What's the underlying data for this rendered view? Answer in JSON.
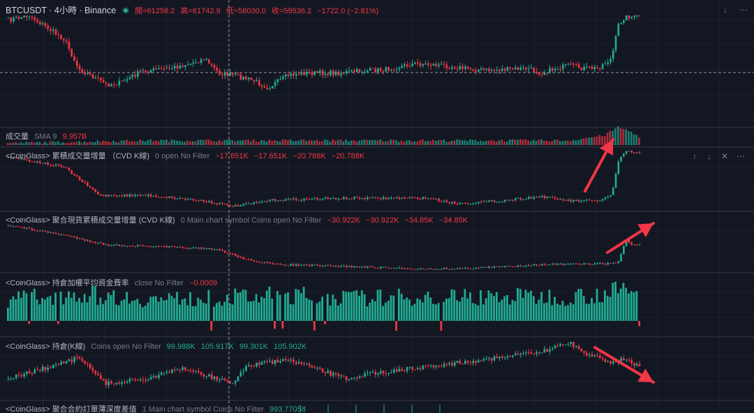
{
  "header": {
    "symbol": "BTCUSDT · 4小時 · Binance",
    "open": "開=61258.2",
    "high": "高=61742.9",
    "low": "低=58030.0",
    "close": "收=59536.2",
    "change": "−1722.0 (−2.81%)"
  },
  "colors": {
    "up": "#22ab94",
    "down": "#f23645",
    "arrow": "#f23645",
    "bg": "#131722"
  },
  "panels": {
    "volume": {
      "name": "成交量",
      "params": "SMA 9",
      "value": "9.957B"
    },
    "cvd": {
      "name": "<CoinGlass> 累積成交量增量 （CVD K線)",
      "params": "0 open No Filter",
      "values": [
        "−17.651K",
        "−17.651K",
        "−20.788K",
        "−20.788K"
      ]
    },
    "spot_cvd": {
      "name": "<CoinGlass> 聚合現貨累積成交量增量 (CVD K線)",
      "params": "0 Main chart symbol Coins open No Filter",
      "values": [
        "−30.922K",
        "−30.922K",
        "−34.85K",
        "−34.85K"
      ]
    },
    "funding": {
      "name": "<CoinGlass> 持倉加權平均資金費率",
      "params": "close No Filter",
      "value": "−0.0009"
    },
    "oi": {
      "name": "<CoinGlass> 持倉(K線)",
      "params": "Coins open No Filter",
      "values": [
        "99.988K",
        "105.917K",
        "99.301K",
        "105.902K"
      ]
    },
    "depth": {
      "name": "<CoinGlass> 聚合合約訂單薄深度差值",
      "params": "1 Main chart symbol Coins No Filter",
      "value": "993.77058"
    }
  },
  "chart_data": [
    {
      "type": "candlestick",
      "name": "BTCUSDT 4h price",
      "points": [
        [
          0,
          0.05
        ],
        [
          3,
          0.0
        ],
        [
          8,
          0.25
        ],
        [
          10,
          0.55
        ],
        [
          14,
          0.72
        ],
        [
          16,
          0.7
        ],
        [
          19,
          0.58
        ],
        [
          23,
          0.55
        ],
        [
          26,
          0.5
        ],
        [
          28,
          0.45
        ],
        [
          30,
          0.6
        ],
        [
          32,
          0.62
        ],
        [
          35,
          0.68
        ],
        [
          37,
          0.75
        ],
        [
          40,
          0.62
        ],
        [
          42,
          0.6
        ],
        [
          47,
          0.6
        ],
        [
          50,
          0.58
        ],
        [
          54,
          0.56
        ],
        [
          58,
          0.5
        ],
        [
          62,
          0.52
        ],
        [
          65,
          0.55
        ],
        [
          68,
          0.57
        ],
        [
          71,
          0.56
        ],
        [
          74,
          0.55
        ],
        [
          76,
          0.6
        ],
        [
          78,
          0.55
        ],
        [
          80,
          0.52
        ],
        [
          82,
          0.55
        ],
        [
          84,
          0.55
        ],
        [
          86,
          0.45
        ],
        [
          87,
          0.1
        ],
        [
          88,
          0.0
        ],
        [
          89,
          0.02
        ],
        [
          90,
          0.0
        ]
      ]
    },
    {
      "type": "volume",
      "name": "Volume",
      "points": [
        [
          0,
          0.05
        ],
        [
          20,
          0.2
        ],
        [
          40,
          0.2
        ],
        [
          60,
          0.2
        ],
        [
          80,
          0.2
        ],
        [
          85,
          0.5
        ],
        [
          87,
          1.0
        ],
        [
          89,
          0.7
        ],
        [
          90,
          0.4
        ]
      ]
    },
    {
      "type": "candlestick",
      "name": "CVD",
      "points": [
        [
          0,
          0.1
        ],
        [
          8,
          0.3
        ],
        [
          13,
          0.8
        ],
        [
          20,
          0.8
        ],
        [
          28,
          0.9
        ],
        [
          32,
          1.0
        ],
        [
          38,
          0.88
        ],
        [
          50,
          0.85
        ],
        [
          60,
          0.85
        ],
        [
          64,
          0.95
        ],
        [
          70,
          0.9
        ],
        [
          76,
          0.82
        ],
        [
          80,
          0.9
        ],
        [
          84,
          0.9
        ],
        [
          86,
          0.8
        ],
        [
          87,
          0.2
        ],
        [
          88,
          0.0
        ],
        [
          89,
          0.03
        ],
        [
          90,
          0.05
        ]
      ]
    },
    {
      "type": "candlestick",
      "name": "Spot CVD",
      "points": [
        [
          0,
          0.1
        ],
        [
          8,
          0.3
        ],
        [
          14,
          0.5
        ],
        [
          24,
          0.55
        ],
        [
          30,
          0.6
        ],
        [
          34,
          0.8
        ],
        [
          38,
          0.9
        ],
        [
          50,
          0.95
        ],
        [
          60,
          1.0
        ],
        [
          65,
          0.98
        ],
        [
          70,
          0.95
        ],
        [
          76,
          0.9
        ],
        [
          80,
          0.9
        ],
        [
          86,
          0.88
        ],
        [
          87,
          0.85
        ],
        [
          88,
          0.4
        ],
        [
          89,
          0.5
        ],
        [
          90,
          0.5
        ]
      ]
    },
    {
      "type": "bar",
      "name": "Funding rate",
      "points": [
        [
          0,
          0.7
        ],
        [
          10,
          0.9
        ],
        [
          20,
          0.7
        ],
        [
          30,
          0.75
        ],
        [
          40,
          0.85
        ],
        [
          50,
          0.75
        ],
        [
          60,
          0.8
        ],
        [
          70,
          0.8
        ],
        [
          80,
          0.8
        ],
        [
          85,
          0.9
        ],
        [
          88,
          1.0
        ],
        [
          90,
          0.95
        ]
      ]
    },
    {
      "type": "candlestick",
      "name": "Open interest",
      "points": [
        [
          0,
          0.7
        ],
        [
          8,
          0.4
        ],
        [
          10,
          0.3
        ],
        [
          14,
          0.8
        ],
        [
          20,
          0.7
        ],
        [
          25,
          0.5
        ],
        [
          32,
          0.8
        ],
        [
          34,
          0.45
        ],
        [
          40,
          0.35
        ],
        [
          48,
          0.7
        ],
        [
          52,
          0.6
        ],
        [
          58,
          0.5
        ],
        [
          64,
          0.4
        ],
        [
          70,
          0.3
        ],
        [
          76,
          0.2
        ],
        [
          80,
          0.0
        ],
        [
          82,
          0.2
        ],
        [
          86,
          0.4
        ],
        [
          88,
          0.3
        ],
        [
          90,
          0.5
        ]
      ]
    }
  ]
}
